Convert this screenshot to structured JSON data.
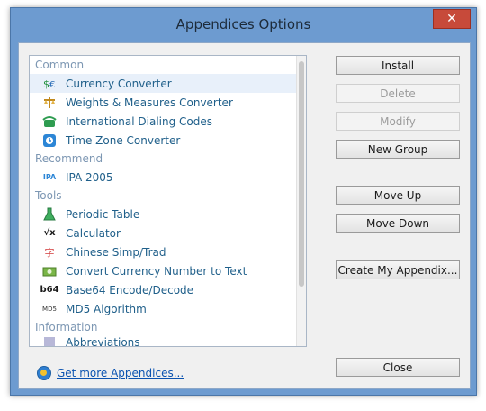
{
  "window": {
    "title": "Appendices Options",
    "close_symbol": "✕"
  },
  "list": {
    "groups": [
      {
        "title": "Common",
        "items": [
          {
            "label": "Currency Converter",
            "icon": "currency-converter-icon",
            "selected": true
          },
          {
            "label": "Weights & Measures Converter",
            "icon": "scale-icon"
          },
          {
            "label": "International Dialing Codes",
            "icon": "phone-icon"
          },
          {
            "label": "Time Zone Converter",
            "icon": "clock-icon"
          }
        ]
      },
      {
        "title": "Recommend",
        "items": [
          {
            "label": "IPA 2005",
            "icon": "ipa-icon"
          }
        ]
      },
      {
        "title": "Tools",
        "items": [
          {
            "label": "Periodic Table",
            "icon": "flask-icon"
          },
          {
            "label": "Calculator",
            "icon": "sqrt-icon"
          },
          {
            "label": "Chinese Simp/Trad",
            "icon": "chinese-char-icon"
          },
          {
            "label": "Convert Currency Number to Text",
            "icon": "money-icon"
          },
          {
            "label": "Base64 Encode/Decode",
            "icon": "b64-icon"
          },
          {
            "label": "MD5 Algorithm",
            "icon": "md5-icon"
          }
        ]
      },
      {
        "title": "Information",
        "items": [
          {
            "label": "Abbreviations",
            "icon": "abbreviation-icon"
          }
        ]
      }
    ]
  },
  "buttons": {
    "install": "Install",
    "delete": "Delete",
    "modify": "Modify",
    "new_group": "New Group",
    "move_up": "Move Up",
    "move_down": "Move Down",
    "create_appendix": "Create My Appendix...",
    "close": "Close"
  },
  "footer": {
    "link": "Get more Appendices..."
  },
  "icon_glyphs": {
    "currency": "$",
    "ipa": "IPA",
    "sqrt": "√x",
    "chinese": "字",
    "b64": "b64",
    "md5": "MD5"
  }
}
